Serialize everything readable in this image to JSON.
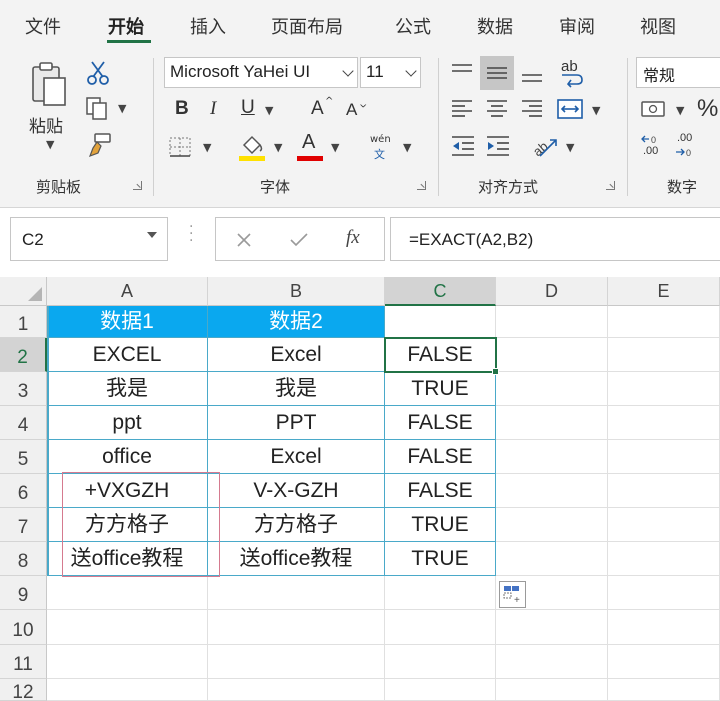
{
  "ribbon": {
    "tabs": [
      {
        "label": "文件",
        "active": false
      },
      {
        "label": "开始",
        "active": true
      },
      {
        "label": "插入",
        "active": false
      },
      {
        "label": "页面布局",
        "active": false
      },
      {
        "label": "公式",
        "active": false
      },
      {
        "label": "数据",
        "active": false
      },
      {
        "label": "审阅",
        "active": false
      },
      {
        "label": "视图",
        "active": false
      }
    ],
    "accent_color": "#217346",
    "clipboard": {
      "paste_label": "粘贴",
      "group_label": "剪贴板",
      "icons": [
        "clipboard-icon",
        "cut-icon",
        "copy-icon",
        "format-painter-icon"
      ]
    },
    "font": {
      "font_name": "Microsoft YaHei UI",
      "font_size": "11",
      "bold": "B",
      "italic": "I",
      "underline": "U",
      "grow": "A",
      "shrink": "A",
      "font_color_letter": "A",
      "phonetic_top": "wén",
      "phonetic_bottom": "文",
      "group_label": "字体",
      "highlight_color": "#ffe100",
      "font_color": "#e00000"
    },
    "alignment": {
      "wrap_text_label": "ab",
      "group_label": "对齐方式",
      "icons": [
        "align-top-icon",
        "align-middle-icon",
        "align-bottom-icon",
        "wrap-text-icon",
        "align-left-icon",
        "align-center-icon",
        "align-right-icon",
        "merge-center-icon",
        "decrease-indent-icon",
        "increase-indent-icon",
        "orientation-icon"
      ]
    },
    "number": {
      "format": "常规",
      "percent": "%",
      "inc_decimal": ".00",
      "dec_decimal": ".00",
      "group_label": "数字",
      "icons": [
        "currency-icon",
        "percent-icon",
        "increase-decimal-icon",
        "decrease-decimal-icon"
      ]
    }
  },
  "formula_bar": {
    "name_box": "C2",
    "fx_label": "fx",
    "formula": "=EXACT(A2,B2)"
  },
  "sheet": {
    "columns": [
      "A",
      "B",
      "C",
      "D",
      "E"
    ],
    "selected_column": "C",
    "rows": [
      "1",
      "2",
      "3",
      "4",
      "5",
      "6",
      "7",
      "8",
      "9",
      "10",
      "11",
      "12"
    ],
    "selected_row": "2",
    "active_cell": "C2",
    "header_fill": "#0aa8ef",
    "table": [
      [
        "数据1",
        "数据2",
        ""
      ],
      [
        "EXCEL",
        "Excel",
        "FALSE"
      ],
      [
        "我是",
        "我是",
        "TRUE"
      ],
      [
        "ppt",
        "PPT",
        "FALSE"
      ],
      [
        "office",
        "Excel",
        "FALSE"
      ],
      [
        "+VXGZH",
        "V-X-GZH",
        "FALSE"
      ],
      [
        "方方格子",
        "方方格子",
        "TRUE"
      ],
      [
        "送office教程",
        "送office教程",
        "TRUE"
      ]
    ]
  }
}
